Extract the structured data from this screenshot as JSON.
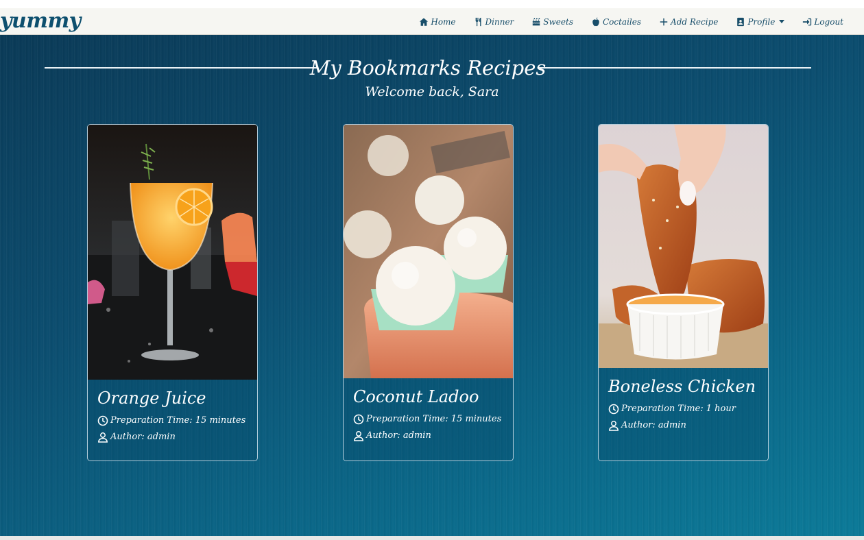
{
  "brand": "yummy",
  "nav": {
    "home": "Home",
    "dinner": "Dinner",
    "sweets": "Sweets",
    "coctailes": "Coctailes",
    "add_recipe": "Add Recipe",
    "profile": "Profile",
    "logout": "Logout"
  },
  "page": {
    "title": "My Bookmarks Recipes",
    "welcome": "Welcome back, Sara"
  },
  "cards": [
    {
      "title": "Orange Juice",
      "prep": "Preparation Time: 15 minutes",
      "author": "Author: admin"
    },
    {
      "title": "Coconut Ladoo",
      "prep": "Preparation Time: 15 minutes",
      "author": "Author: admin"
    },
    {
      "title": "Boneless Chicken",
      "prep": "Preparation Time: 1 hour",
      "author": "Author: admin"
    }
  ],
  "colors": {
    "nav_text": "#184e6a",
    "brand": "#0d4f6e",
    "background_dark": "#0a3a57",
    "background_light": "#0b7a98"
  },
  "icons": {
    "home": "home-icon",
    "dinner": "utensils-icon",
    "sweets": "cake-icon",
    "coctailes": "apple-icon",
    "add_recipe": "plus-icon",
    "profile": "id-badge-icon",
    "logout": "sign-in-icon",
    "prep": "clock-icon",
    "author": "user-icon"
  }
}
